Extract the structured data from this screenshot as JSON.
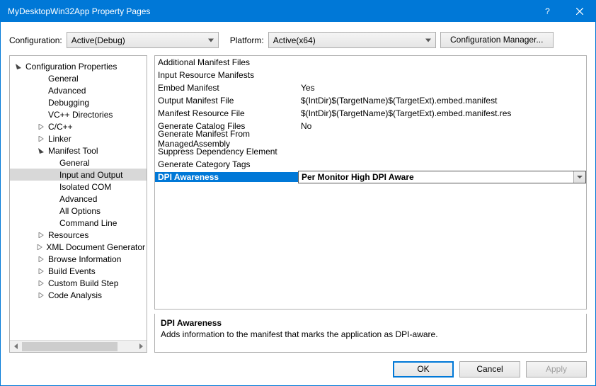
{
  "window": {
    "title": "MyDesktopWin32App Property Pages"
  },
  "toolbar": {
    "config_label": "Configuration:",
    "config_value": "Active(Debug)",
    "platform_label": "Platform:",
    "platform_value": "Active(x64)",
    "cfgmgr_label": "Configuration Manager..."
  },
  "tree": {
    "root": "Configuration Properties",
    "items": [
      {
        "label": "General",
        "depth": 2,
        "expander": ""
      },
      {
        "label": "Advanced",
        "depth": 2,
        "expander": ""
      },
      {
        "label": "Debugging",
        "depth": 2,
        "expander": ""
      },
      {
        "label": "VC++ Directories",
        "depth": 2,
        "expander": ""
      },
      {
        "label": "C/C++",
        "depth": 2,
        "expander": "closed"
      },
      {
        "label": "Linker",
        "depth": 2,
        "expander": "closed"
      },
      {
        "label": "Manifest Tool",
        "depth": 2,
        "expander": "open"
      },
      {
        "label": "General",
        "depth": 3,
        "expander": ""
      },
      {
        "label": "Input and Output",
        "depth": 3,
        "expander": "",
        "selected": true
      },
      {
        "label": "Isolated COM",
        "depth": 3,
        "expander": ""
      },
      {
        "label": "Advanced",
        "depth": 3,
        "expander": ""
      },
      {
        "label": "All Options",
        "depth": 3,
        "expander": ""
      },
      {
        "label": "Command Line",
        "depth": 3,
        "expander": ""
      },
      {
        "label": "Resources",
        "depth": 2,
        "expander": "closed"
      },
      {
        "label": "XML Document Generator",
        "depth": 2,
        "expander": "closed"
      },
      {
        "label": "Browse Information",
        "depth": 2,
        "expander": "closed"
      },
      {
        "label": "Build Events",
        "depth": 2,
        "expander": "closed"
      },
      {
        "label": "Custom Build Step",
        "depth": 2,
        "expander": "closed"
      },
      {
        "label": "Code Analysis",
        "depth": 2,
        "expander": "closed"
      }
    ]
  },
  "grid": {
    "rows": [
      {
        "name": "Additional Manifest Files",
        "value": ""
      },
      {
        "name": "Input Resource Manifests",
        "value": ""
      },
      {
        "name": "Embed Manifest",
        "value": "Yes"
      },
      {
        "name": "Output Manifest File",
        "value": "$(IntDir)$(TargetName)$(TargetExt).embed.manifest"
      },
      {
        "name": "Manifest Resource File",
        "value": "$(IntDir)$(TargetName)$(TargetExt).embed.manifest.res"
      },
      {
        "name": "Generate Catalog Files",
        "value": "No"
      },
      {
        "name": "Generate Manifest From ManagedAssembly",
        "value": ""
      },
      {
        "name": "Suppress Dependency Element",
        "value": ""
      },
      {
        "name": "Generate Category Tags",
        "value": ""
      },
      {
        "name": "DPI Awareness",
        "value": "Per Monitor High DPI Aware",
        "selected": true
      }
    ]
  },
  "description": {
    "heading": "DPI Awareness",
    "text": "Adds information to the manifest that marks the application as DPI-aware."
  },
  "buttons": {
    "ok": "OK",
    "cancel": "Cancel",
    "apply": "Apply"
  }
}
